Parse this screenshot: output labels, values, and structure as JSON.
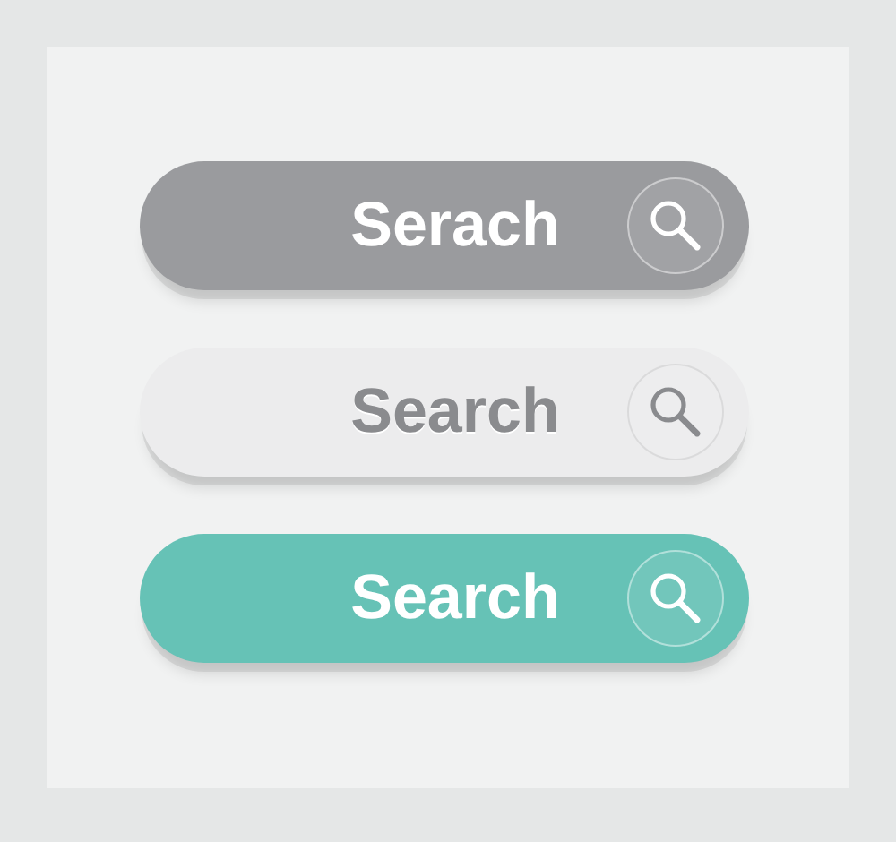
{
  "buttons": [
    {
      "label": "Serach",
      "color": "#9a9b9e"
    },
    {
      "label": "Search",
      "color": "#ececed"
    },
    {
      "label": "Search",
      "color": "#66c2b6"
    }
  ]
}
